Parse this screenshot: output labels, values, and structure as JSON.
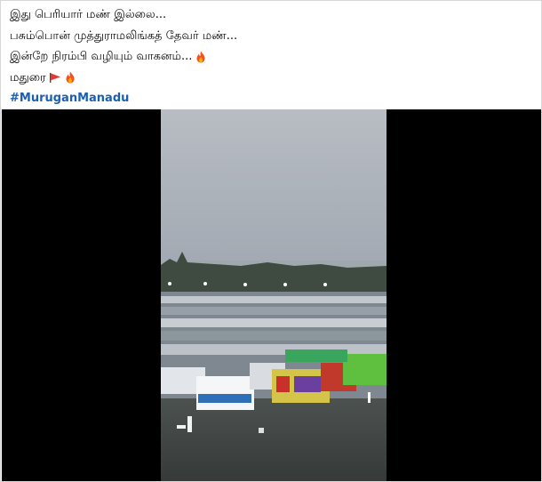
{
  "post": {
    "lines": [
      "இது பெரியார் மண் இல்லை...",
      "பசும்பொன் முத்துராமலிங்கத் தேவர் மண்...",
      "இன்றே நிரம்பி வழியும் வாகனம்..."
    ],
    "city": "மதுரை",
    "hashtag": "#MuruganManadu"
  },
  "icons": {
    "fire": "fire-icon",
    "flag": "red-flag-icon"
  },
  "colors": {
    "hashtag": "#1a5fb4",
    "video_background": "#000000",
    "sky": "#a9afb8",
    "ground": "#3e4340"
  }
}
